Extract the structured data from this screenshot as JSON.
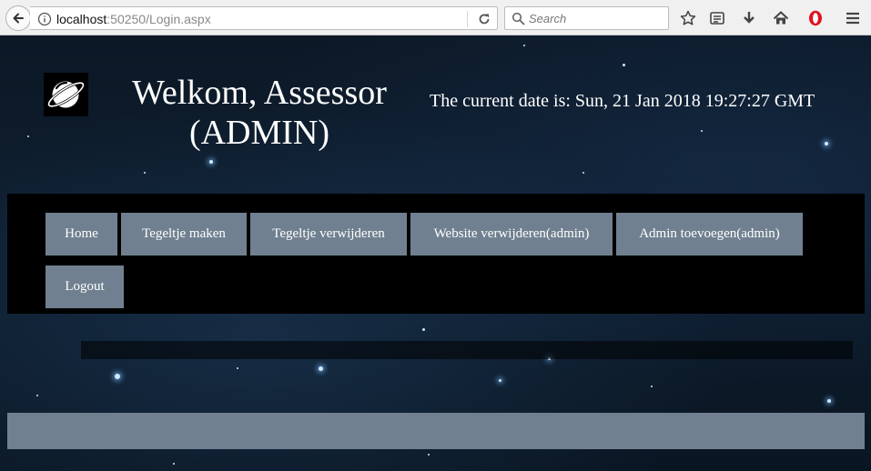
{
  "browser": {
    "url_host": "localhost",
    "url_rest": ":50250/Login.aspx",
    "search_placeholder": "Search"
  },
  "header": {
    "welcome": "Welkom, Assessor (ADMIN)",
    "date_text": "The current date is: Sun, 21 Jan 2018 19:27:27 GMT"
  },
  "nav": {
    "home": "Home",
    "create_tile": "Tegeltje maken",
    "delete_tile": "Tegeltje verwijderen",
    "delete_website": "Website verwijderen(admin)",
    "add_admin": "Admin toevoegen(admin)",
    "logout": "Logout"
  },
  "colors": {
    "nav_button": "#708090",
    "navbar_bg": "#000000",
    "text": "#ffffff"
  }
}
